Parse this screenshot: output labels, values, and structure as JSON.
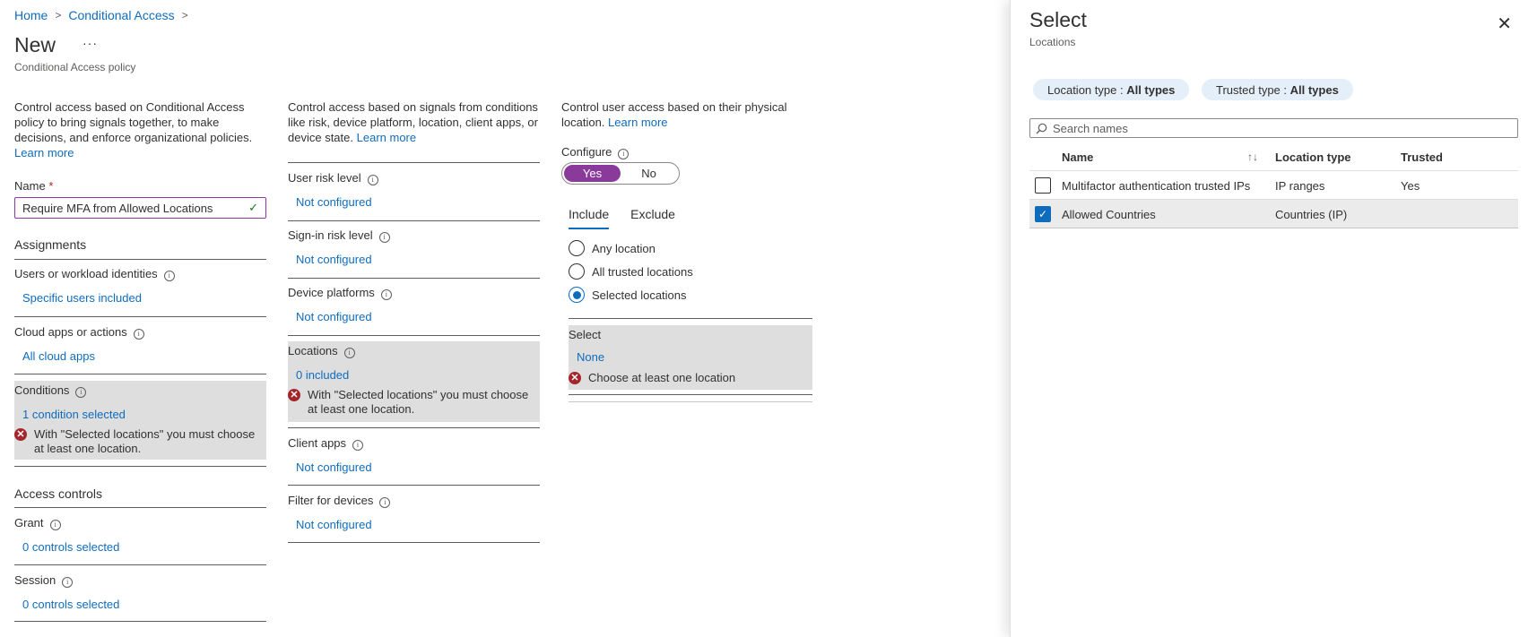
{
  "breadcrumb": {
    "home": "Home",
    "conditional_access": "Conditional Access",
    "separator": ">"
  },
  "page": {
    "title": "New",
    "more": "···",
    "subtitle": "Conditional Access policy"
  },
  "col1": {
    "description": "Control access based on Conditional Access policy to bring signals together, to make decisions, and enforce organizational policies.",
    "learn_more": "Learn more",
    "name_label": "Name",
    "required_mark": "*",
    "name_value": "Require MFA from Allowed Locations",
    "assignments_title": "Assignments",
    "users_label": "Users or workload identities",
    "users_value": "Specific users included",
    "cloud_label": "Cloud apps or actions",
    "cloud_value": "All cloud apps",
    "conditions_label": "Conditions",
    "conditions_value": "1 condition selected",
    "conditions_error": "With \"Selected locations\" you must choose at least one location.",
    "access_title": "Access controls",
    "grant_label": "Grant",
    "grant_value": "0 controls selected",
    "session_label": "Session",
    "session_value": "0 controls selected"
  },
  "col2": {
    "description": "Control access based on signals from conditions like risk, device platform, location, client apps, or device state.",
    "learn_more": "Learn more",
    "user_risk_label": "User risk level",
    "user_risk_value": "Not configured",
    "signin_risk_label": "Sign-in risk level",
    "signin_risk_value": "Not configured",
    "device_platforms_label": "Device platforms",
    "device_platforms_value": "Not configured",
    "locations_label": "Locations",
    "locations_value": "0 included",
    "locations_error": "With \"Selected locations\" you must choose at least one location.",
    "client_apps_label": "Client apps",
    "client_apps_value": "Not configured",
    "filter_label": "Filter for devices",
    "filter_value": "Not configured"
  },
  "col3": {
    "description": "Control user access based on their physical location.",
    "learn_more": "Learn more",
    "configure_label": "Configure",
    "toggle_yes": "Yes",
    "toggle_no": "No",
    "tab_include": "Include",
    "tab_exclude": "Exclude",
    "radio_any": "Any location",
    "radio_trusted": "All trusted locations",
    "radio_selected": "Selected locations",
    "select_label": "Select",
    "select_value": "None",
    "select_error": "Choose at least one location"
  },
  "panel": {
    "title": "Select",
    "subtitle": "Locations",
    "close": "✕",
    "filter_location_label": "Location type : ",
    "filter_location_value": "All types",
    "filter_trusted_label": "Trusted type : ",
    "filter_trusted_value": "All types",
    "search_placeholder": "Search names",
    "columns": {
      "name": "Name",
      "sort": "↑↓",
      "location_type": "Location type",
      "trusted": "Trusted"
    },
    "rows": [
      {
        "name": "Multifactor authentication trusted IPs",
        "location_type": "IP ranges",
        "trusted": "Yes",
        "checked": false
      },
      {
        "name": "Allowed Countries",
        "location_type": "Countries (IP)",
        "trusted": "",
        "checked": true
      }
    ]
  },
  "colors": {
    "accent": "#8a3a9b",
    "link": "#0f6cbd",
    "error": "#a4262c"
  }
}
